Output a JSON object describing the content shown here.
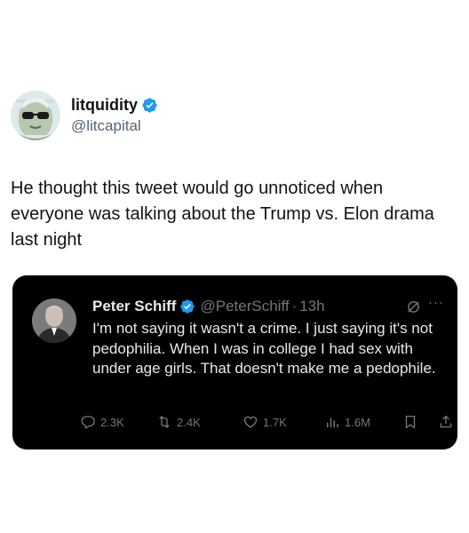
{
  "post": {
    "author": {
      "display_name": "litquidity",
      "handle": "@litcapital",
      "verified": true,
      "avatar_icon": "sunglasses-bill-avatar"
    },
    "text": "He thought this tweet would go unnoticed when everyone was talking about the Trump vs. Elon drama last night"
  },
  "quoted_post": {
    "author": {
      "display_name": "Peter Schiff",
      "handle": "@PeterSchiff",
      "separator": "·",
      "time": "13h",
      "verified": true,
      "avatar_icon": "user-photo-avatar"
    },
    "text": "I'm not saying it wasn't a crime.  I just saying it's not pedophilia. When I was in college I had sex with under age girls. That doesn't make me a pedophile.",
    "more_label": "···",
    "actions": {
      "replies": "2.3K",
      "reposts": "2.4K",
      "likes": "1.7K",
      "views": "1.6M"
    }
  },
  "colors": {
    "verified_blue": "#1d9bf0",
    "card_background": "#000000",
    "secondary_text_dark": "#71767b",
    "secondary_text_light": "#536471"
  }
}
